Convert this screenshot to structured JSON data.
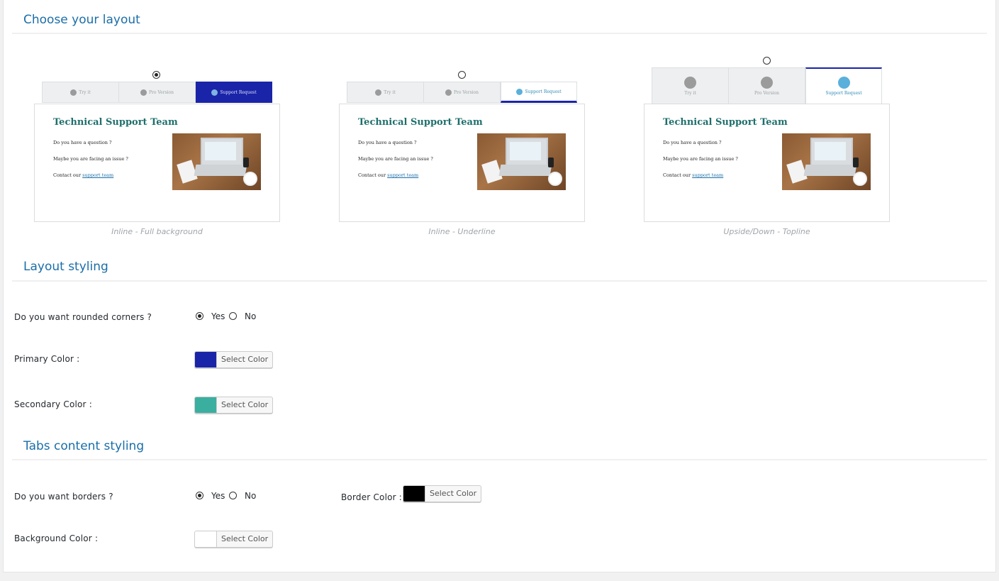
{
  "sections": {
    "choose_layout": "Choose your layout",
    "layout_styling": "Layout styling",
    "tabs_content_styling": "Tabs content styling"
  },
  "layouts": [
    {
      "caption": "Inline - Full background",
      "selected": true,
      "tabs": [
        "Try it",
        "Pro Version",
        "Support Request"
      ]
    },
    {
      "caption": "Inline - Underline",
      "selected": false,
      "tabs": [
        "Try it",
        "Pro Version",
        "Support Request"
      ]
    },
    {
      "caption": "Upside/Down - Topline",
      "selected": false,
      "tabs": [
        "Try it",
        "Pro Version",
        "Support Request"
      ]
    }
  ],
  "preview_card": {
    "title": "Technical Support Team",
    "line1": "Do you have a question ?",
    "line2": "Maybe you are facing an issue ?",
    "line3_prefix": "Contact our",
    "line3_link": "support team"
  },
  "layout_styling": {
    "rounded_label": "Do you want rounded corners ?",
    "rounded_value": "Yes",
    "yes": "Yes",
    "no": "No",
    "primary_label": "Primary Color :",
    "primary_color": "#1a24a8",
    "secondary_label": "Secondary Color :",
    "secondary_color": "#3aafa0",
    "select_color": "Select Color"
  },
  "tabs_content": {
    "borders_label": "Do you want borders ?",
    "borders_value": "Yes",
    "yes": "Yes",
    "no": "No",
    "border_color_label": "Border Color :",
    "border_color": "#000000",
    "background_label": "Background Color :",
    "background_color": "#ffffff",
    "select_color": "Select Color"
  },
  "icons": {
    "tab_icon": "circle-avatar-icon"
  }
}
